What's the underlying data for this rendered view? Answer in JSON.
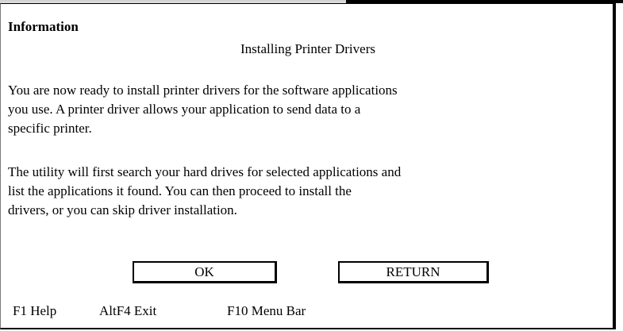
{
  "dialog": {
    "title": "Information",
    "subtitle": "Installing Printer Drivers",
    "paragraphs": [
      "You are now ready to install printer drivers for the software applications\nyou use. A printer driver allows your application to send data to a\nspecific printer.",
      "The utility will first search your hard drives for selected applications and\nlist the applications it found. You can then proceed to install the\ndrivers, or you can skip driver installation."
    ]
  },
  "buttons": {
    "ok_label": "OK",
    "return_label": "RETURN"
  },
  "function_keys": [
    "F1 Help",
    "AltF4 Exit",
    "F10 Menu Bar"
  ],
  "colors": {
    "background": "#ffffff",
    "border": "#000000",
    "text": "#000000"
  }
}
